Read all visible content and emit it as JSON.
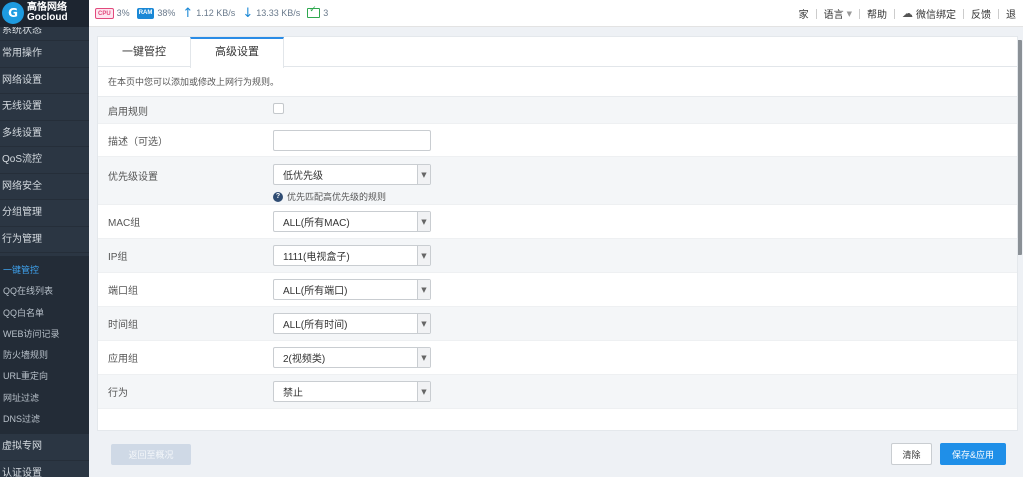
{
  "brand": {
    "name_cn": "高恪网络",
    "name_en": "Gocloud",
    "logo_letter": "G"
  },
  "stats": {
    "cpu_label": "CPU",
    "cpu_value": "3%",
    "ram_label": "RAM",
    "ram_value": "38%",
    "upload": "1.12 KB/s",
    "download": "13.33 KB/s",
    "devices": "3"
  },
  "topnav": {
    "home": "家",
    "language": "语言",
    "help": "帮助",
    "wechat": "微信绑定",
    "feedback": "反馈",
    "logout": "退"
  },
  "sidebar": {
    "items": [
      {
        "label": "系统状态"
      },
      {
        "label": "常用操作"
      },
      {
        "label": "网络设置"
      },
      {
        "label": "无线设置"
      },
      {
        "label": "多线设置"
      },
      {
        "label": "QoS流控"
      },
      {
        "label": "网络安全"
      },
      {
        "label": "分组管理"
      },
      {
        "label": "行为管理"
      }
    ],
    "subitems": [
      {
        "label": "一键管控"
      },
      {
        "label": "QQ在线列表"
      },
      {
        "label": "QQ白名单"
      },
      {
        "label": "WEB访问记录"
      },
      {
        "label": "防火墙规则"
      },
      {
        "label": "URL重定向"
      },
      {
        "label": "网址过滤"
      },
      {
        "label": "DNS过滤"
      }
    ],
    "after": [
      {
        "label": "虚拟专网"
      },
      {
        "label": "认证设置"
      }
    ]
  },
  "tabs": [
    {
      "label": "一键管控"
    },
    {
      "label": "高级设置"
    }
  ],
  "description": "在本页中您可以添加或修改上网行为规则。",
  "form": {
    "enable_label": "启用规则",
    "desc_label": "描述（可选）",
    "desc_value": "",
    "priority_label": "优先级设置",
    "priority_value": "低优先级",
    "priority_hint": "优先匹配高优先级的规则",
    "mac_label": "MAC组",
    "mac_value": "ALL(所有MAC)",
    "ip_label": "IP组",
    "ip_value": "1111(电视盒子)",
    "port_label": "端口组",
    "port_value": "ALL(所有端口)",
    "time_label": "时间组",
    "time_value": "ALL(所有时间)",
    "app_label": "应用组",
    "app_value": "2(视频类)",
    "action_label": "行为",
    "action_value": "禁止"
  },
  "buttons": {
    "back": "返回至概况",
    "clear": "清除",
    "save": "保存&应用"
  },
  "colors": {
    "accent": "#1f8fe8",
    "sidebar_bg": "#2b3643",
    "sub_active": "#3fa4f0"
  }
}
